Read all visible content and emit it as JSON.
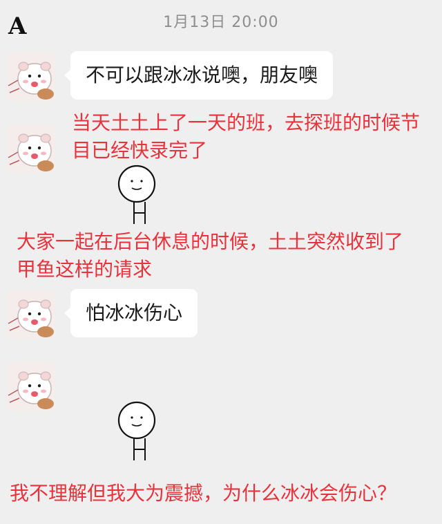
{
  "label": "A",
  "timestamp": "1月13日 20:00",
  "messages": [
    {
      "text": "不可以跟冰冰说噢，朋友噢"
    },
    {
      "text": "怕冰冰伤心"
    }
  ],
  "captions": [
    {
      "line1": "当天土土上了一天的班，去探班的时候节",
      "line2": "目已经快录完了"
    },
    {
      "line1": "大家一起在后台休息的时候，土土突然收到了",
      "line2": "甲鱼这样的请求"
    },
    {
      "line1": "我不理解但我大为震撼，为什么冰冰会伤心？"
    }
  ],
  "icons": {
    "avatar": "pig-avatar-icon",
    "sticker": "stick-figure-sticker-icon"
  },
  "colors": {
    "background": "#efefef",
    "caption": "#e8323c",
    "bubble": "#ffffff"
  }
}
